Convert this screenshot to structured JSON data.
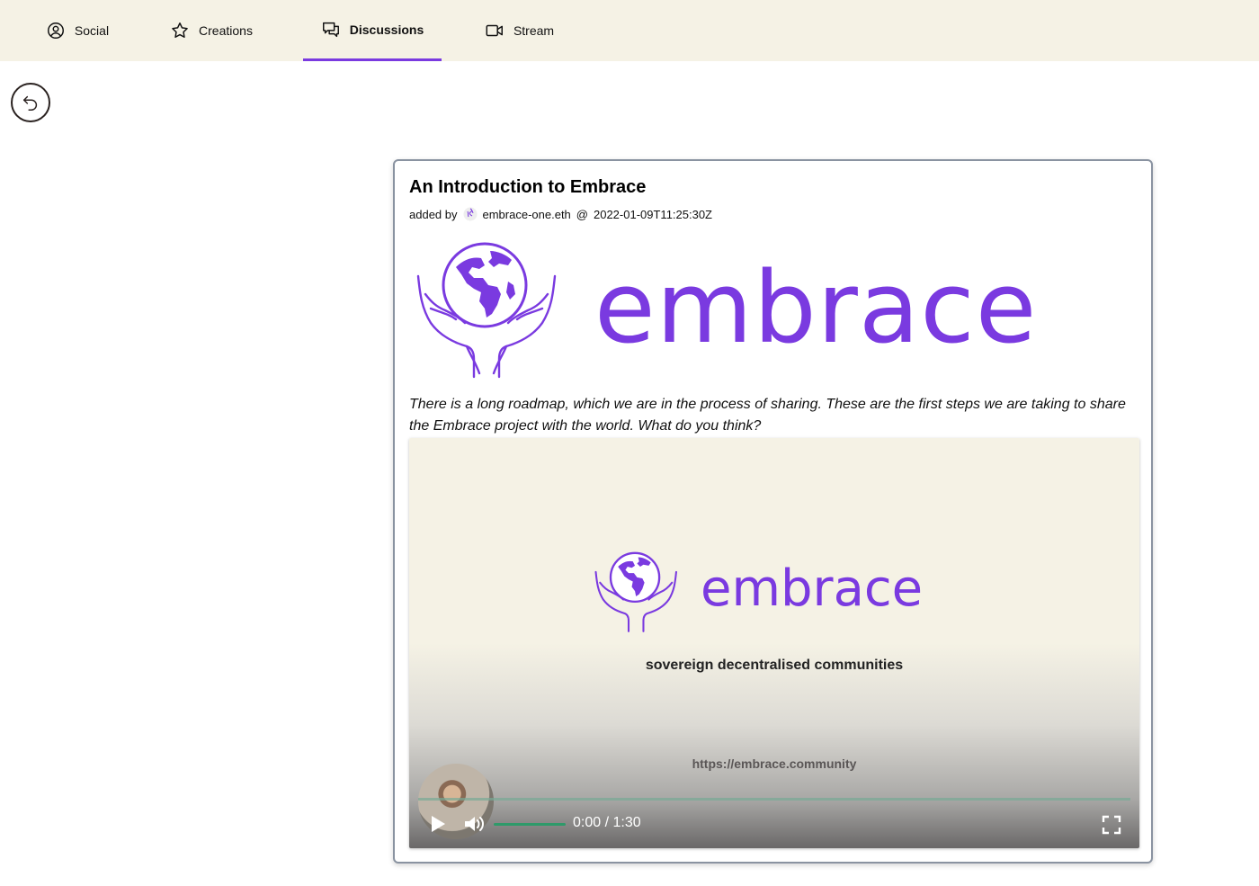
{
  "nav": {
    "tabs": [
      {
        "label": "Social",
        "icon": "user-circle-icon"
      },
      {
        "label": "Creations",
        "icon": "star-icon"
      },
      {
        "label": "Discussions",
        "icon": "chat-bubbles-icon",
        "active": true
      },
      {
        "label": "Stream",
        "icon": "video-camera-icon"
      }
    ]
  },
  "back": {
    "icon": "undo-arrow-icon"
  },
  "post": {
    "title": "An Introduction to Embrace",
    "added_by_label": "added by",
    "author": "embrace-one.eth",
    "at": "@",
    "timestamp": "2022-01-09T11:25:30Z",
    "logo_word": "embrace",
    "body": "There is a long roadmap, which we are in the process of sharing. These are the first steps we are taking to share the Embrace project with the world. What do you think?"
  },
  "video": {
    "logo_word": "embrace",
    "tagline": "sovereign decentralised communities",
    "url": "https://embrace.community",
    "time": "0:00 / 1:30",
    "progress": 0,
    "volume": 1.0
  },
  "colors": {
    "brand_purple": "#7a3ae0",
    "nav_background": "#f5f2e5",
    "volume_green": "#2f9a6a"
  }
}
